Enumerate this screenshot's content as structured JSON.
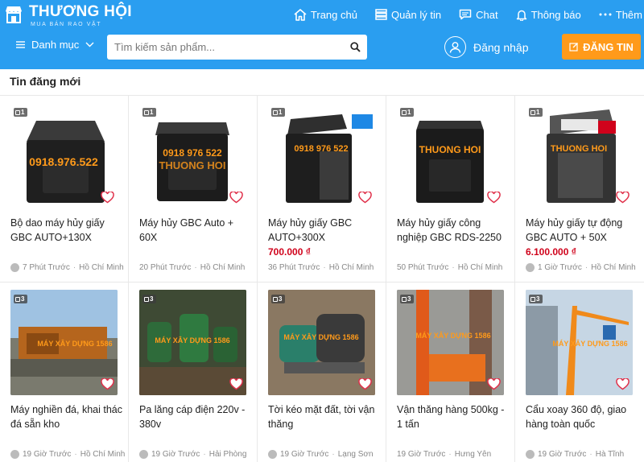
{
  "header": {
    "logo_title": "THƯƠNG HỘI",
    "logo_subtitle": "MUA BÁN RAO VẶT",
    "nav": [
      {
        "label": "Trang chủ",
        "icon": "home-icon"
      },
      {
        "label": "Quản lý tin",
        "icon": "list-icon"
      },
      {
        "label": "Chat",
        "icon": "chat-icon"
      },
      {
        "label": "Thông báo",
        "icon": "bell-icon"
      },
      {
        "label": "Thêm",
        "icon": "more-dots-icon"
      }
    ],
    "category_label": "Danh mục",
    "search_placeholder": "Tìm kiếm sản phẩm...",
    "login_label": "Đăng nhập",
    "post_label": "ĐĂNG TIN"
  },
  "colors": {
    "header_bg": "#2a9ef0",
    "post_button": "#ff9a1a",
    "price": "#d0021b"
  },
  "section": {
    "title": "Tin đăng mới"
  },
  "listings": [
    {
      "title": "Bộ dao máy hủy giấy GBC AUTO+130X",
      "price": "",
      "time": "7 Phút Trước",
      "location": "Hồ Chí Minh",
      "images": "1"
    },
    {
      "title": "Máy hủy GBC Auto + 60X",
      "price": "",
      "time": "20 Phút Trước",
      "location": "Hồ Chí Minh",
      "images": "1"
    },
    {
      "title": "Máy hủy giấy GBC AUTO+300X",
      "price": "700.000 ₫",
      "time": "36 Phút Trước",
      "location": "Hồ Chí Minh",
      "images": "1"
    },
    {
      "title": "Máy hủy giấy công nghiệp GBC RDS-2250",
      "price": "",
      "time": "50 Phút Trước",
      "location": "Hồ Chí Minh",
      "images": "1"
    },
    {
      "title": "Máy hủy giấy tự động GBC AUTO + 50X",
      "price": "6.100.000 ₫",
      "time": "1 Giờ Trước",
      "location": "Hồ Chí Minh",
      "images": "1"
    },
    {
      "title": "Máy nghiền đá, khai thác đá sẵn kho",
      "price": "",
      "time": "19 Giờ Trước",
      "location": "Hồ Chí Minh",
      "images": "3"
    },
    {
      "title": "Pa lăng cáp điện 220v - 380v",
      "price": "",
      "time": "19 Giờ Trước",
      "location": "Hải Phòng",
      "images": "3"
    },
    {
      "title": "Tời kéo mặt đất, tời vận thăng",
      "price": "",
      "time": "19 Giờ Trước",
      "location": "Lạng Sơn",
      "images": "3"
    },
    {
      "title": "Vận thăng hàng 500kg - 1 tấn",
      "price": "",
      "time": "19 Giờ Trước",
      "location": "Hưng Yên",
      "images": "3"
    },
    {
      "title": "Cẩu xoay 360 độ, giao hàng toàn quốc",
      "price": "",
      "time": "19 Giờ Trước",
      "location": "Hà Tĩnh",
      "images": "3"
    }
  ]
}
